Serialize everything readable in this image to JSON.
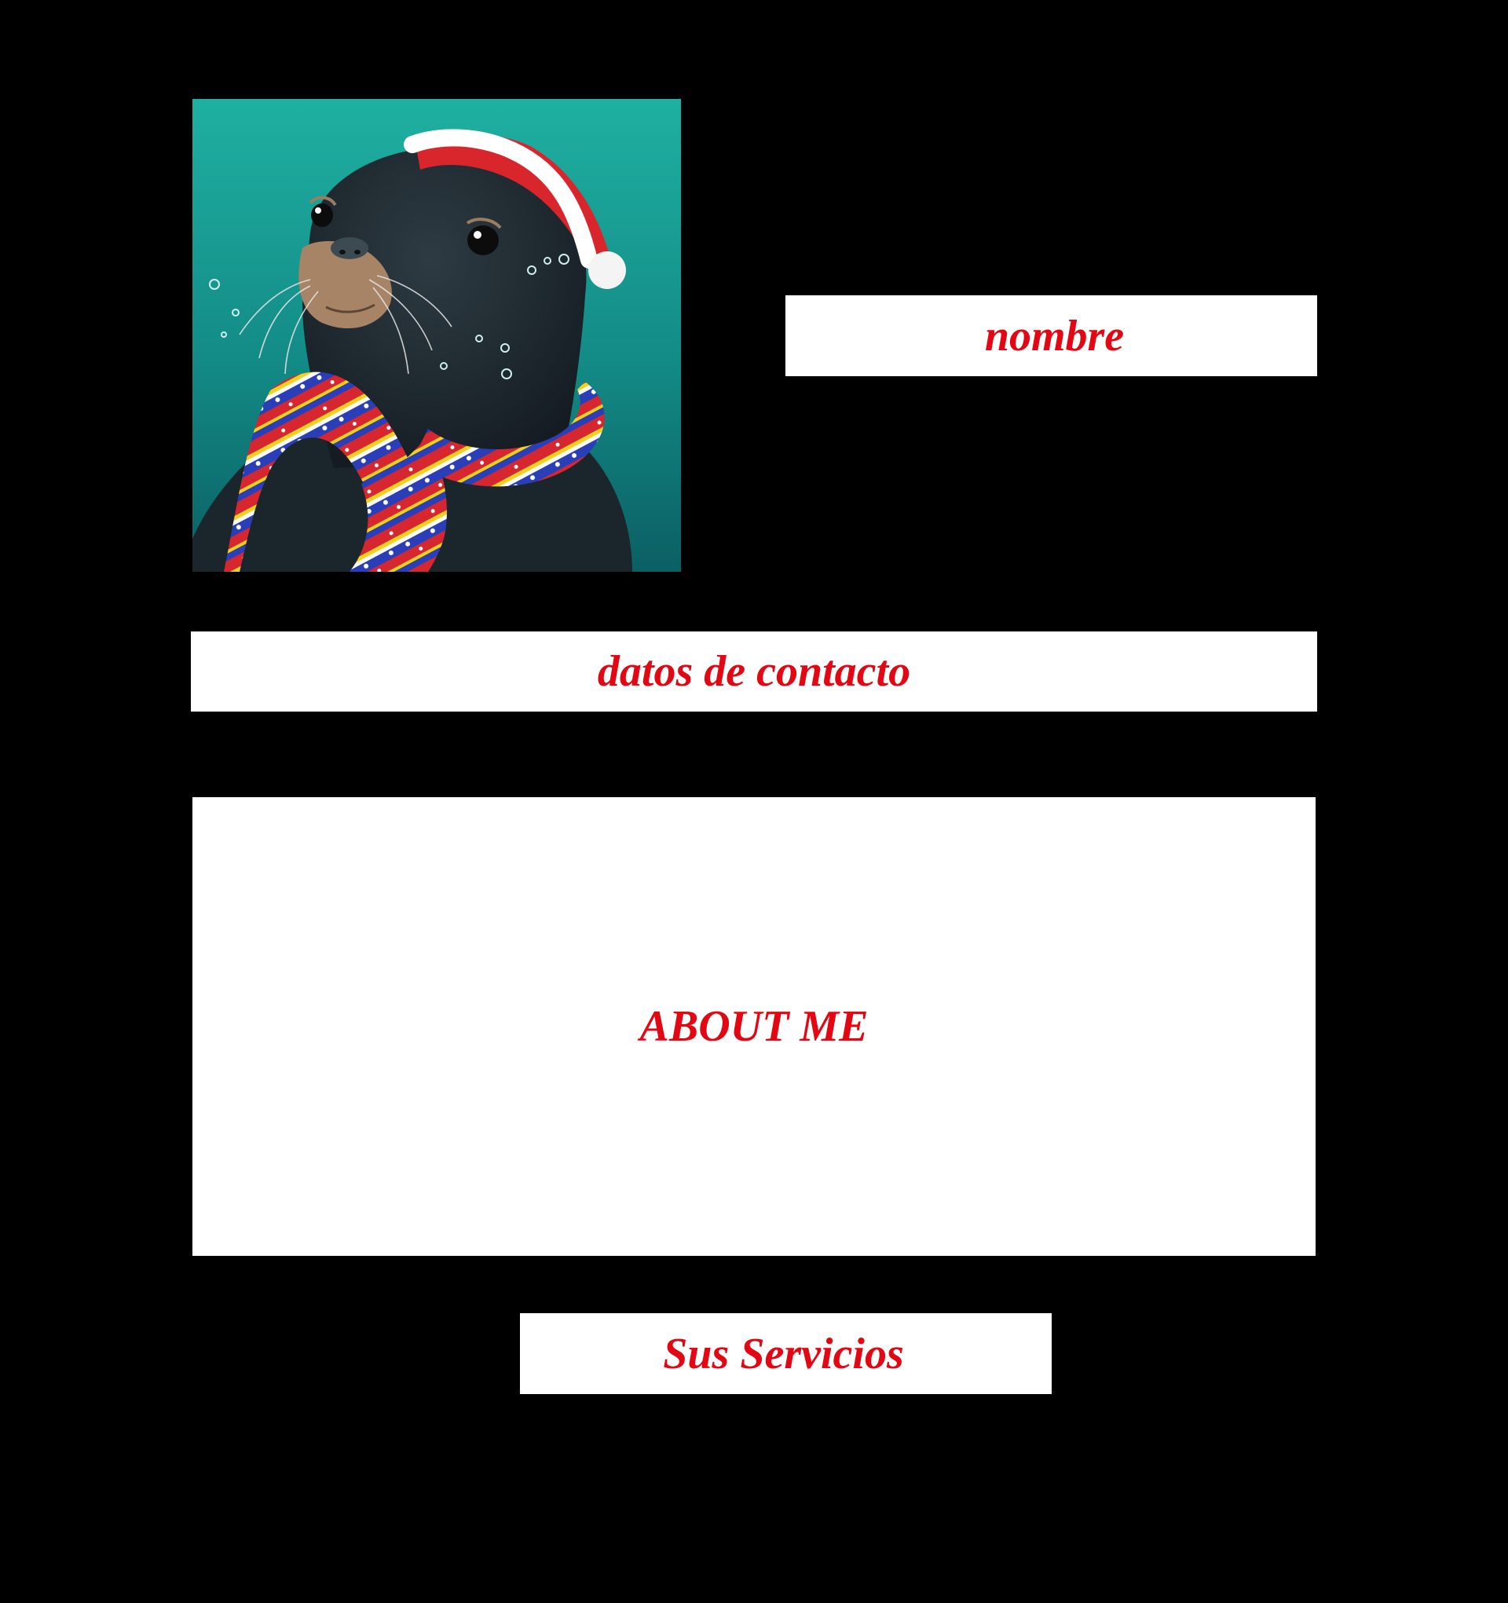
{
  "profile": {
    "photo_alt": "",
    "photo_icon": "seal-with-santa-hat-and-scarf-illustration"
  },
  "fields": {
    "name_label": "nombre",
    "contact_label": "datos de contacto",
    "about_label": "ABOUT ME",
    "services_label": "Sus Servicios"
  },
  "colors": {
    "background": "#000000",
    "box_background": "#ffffff",
    "label_text": "#e30613"
  }
}
